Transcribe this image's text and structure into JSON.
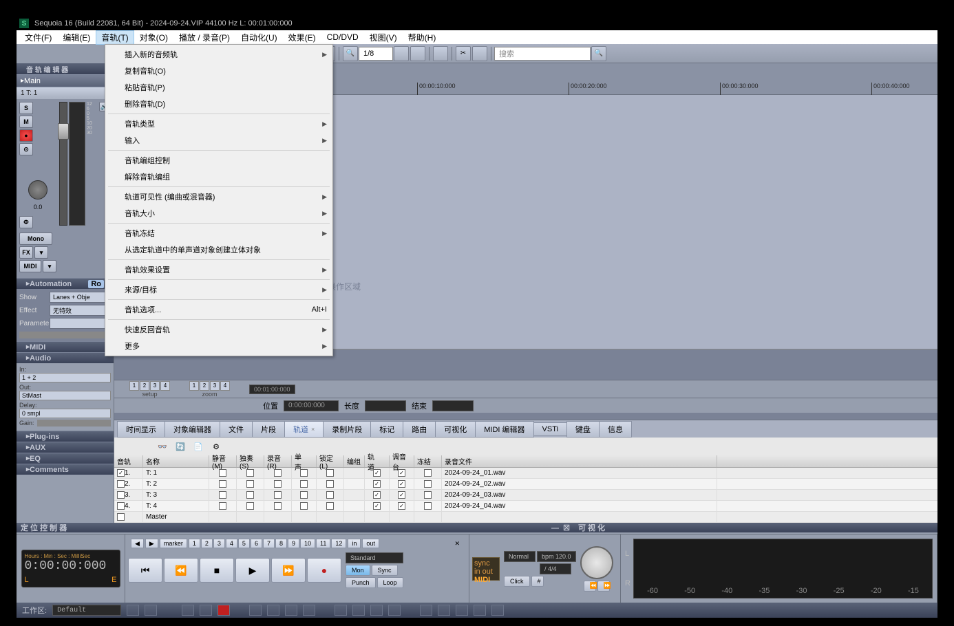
{
  "title": "Sequoia 16 (Build 22081, 64 Bit)  -  2024-09-24.VIP    44100 Hz L: 00:01:00:000",
  "menubar": [
    "文件(F)",
    "编辑(E)",
    "音轨(T)",
    "对象(O)",
    "播放 / 录音(P)",
    "自动化(U)",
    "效果(E)",
    "CD/DVD",
    "视图(V)",
    "帮助(H)"
  ],
  "active_menu_index": 2,
  "dropdown": [
    {
      "label": "插入新的音频轨",
      "sub": true
    },
    {
      "label": "复制音轨(O)"
    },
    {
      "label": "粘贴音轨(P)"
    },
    {
      "label": "删除音轨(D)"
    },
    {
      "sep": true
    },
    {
      "label": "音轨类型",
      "sub": true
    },
    {
      "label": "输入",
      "sub": true
    },
    {
      "sep": true
    },
    {
      "label": "音轨编组控制"
    },
    {
      "label": "解除音轨编组"
    },
    {
      "sep": true
    },
    {
      "label": "轨道可见性 (编曲或混音器)",
      "sub": true
    },
    {
      "label": "音轨大小",
      "sub": true
    },
    {
      "sep": true
    },
    {
      "label": "音轨冻结",
      "sub": true
    },
    {
      "label": "从选定轨道中的单声道对象创建立体对象"
    },
    {
      "sep": true
    },
    {
      "label": "音轨效果设置",
      "sub": true
    },
    {
      "sep": true
    },
    {
      "label": "来源/目标",
      "sub": true
    },
    {
      "sep": true
    },
    {
      "label": "音轨选项...",
      "shortcut": "Alt+I"
    },
    {
      "sep": true
    },
    {
      "label": "快速反回音轨",
      "sub": true
    },
    {
      "label": "更多",
      "sub": true
    }
  ],
  "toolbar": {
    "zoom_ratio": "1/8",
    "search_placeholder": "搜索"
  },
  "panels": {
    "track_editor_header": "音 轨 编 辑 器",
    "main": "Main",
    "track1": "1    T:  1",
    "automation": "Automation",
    "ro": "Ro",
    "show": "Show",
    "show_value": "Lanes + Obje",
    "effect": "Effect",
    "effect_value": "无特效",
    "parameter": "Parameter",
    "midi": "MIDI",
    "audio": "Audio",
    "plugins": "Plug-ins",
    "aux": "AUX",
    "eq": "EQ",
    "comments": "Comments",
    "in": "In:",
    "in_value": "1 + 2",
    "out": "Out:",
    "out_value": "StMast",
    "delay": "Delay:",
    "delay_value": "0 smpl",
    "gain": "Gain:",
    "mono": "Mono",
    "fx": "FX",
    "midi_btn": "MIDI",
    "pan_val": "0.0"
  },
  "ruler": {
    "ticks": [
      "00:00:10:000",
      "00:00:20:000",
      "00:00:30:000",
      "00:00:40:000"
    ],
    "end": "00:01:00:000"
  },
  "zoom": {
    "setup": "setup",
    "zoom": "zoom"
  },
  "pos": {
    "position": "位置",
    "pos_val": "0:00:00:000",
    "length": "长度",
    "end": "结束"
  },
  "tabs": [
    "时间显示",
    "对象编辑器",
    "文件",
    "片段",
    "轨道",
    "录制片段",
    "标记",
    "路由",
    "可视化",
    "MIDI 编辑器",
    "VSTi",
    "键盘",
    "信息"
  ],
  "active_tab": 4,
  "table": {
    "headers": [
      "音轨",
      "名称",
      "静音(M)",
      "独奏(S)",
      "录音(R)",
      "单声...",
      "锁定(L)",
      "编组",
      "轨道...",
      "调音台",
      "冻结",
      "录音文件"
    ],
    "rows": [
      {
        "n": "1.",
        "name": "T:  1",
        "file": "2024-09-24_01.wav",
        "tr": true,
        "mx": true
      },
      {
        "n": "2.",
        "name": "T:  2",
        "file": "2024-09-24_02.wav",
        "tr": true,
        "mx": true
      },
      {
        "n": "3.",
        "name": "T:  3",
        "file": "2024-09-24_03.wav",
        "tr": true,
        "mx": true
      },
      {
        "n": "4.",
        "name": "T:  4",
        "file": "2024-09-24_04.wav",
        "tr": true,
        "mx": true
      },
      {
        "n": "",
        "name": "Master",
        "file": ""
      }
    ]
  },
  "transport": {
    "header": "定 位 控 制 器",
    "vis_header": "可 视 化",
    "td_label": "Hours : Min : Sec : MilliSec",
    "td_time": "0:00:00:000",
    "L": "L",
    "E": "E",
    "marker": "marker",
    "nums": [
      "1",
      "2",
      "3",
      "4",
      "5",
      "6",
      "7",
      "8",
      "9",
      "10",
      "11",
      "12"
    ],
    "in": "in",
    "out": "out",
    "standard": "Standard",
    "mon": "Mon",
    "sync": "Sync",
    "punch": "Punch",
    "loop": "Loop",
    "normal": "Normal",
    "bpm": "bpm 120.0",
    "sig": "/    4/4",
    "sync_box_top": "sync",
    "sync_box_mid": "in out",
    "sync_box_bot": "MIDI",
    "click": "Click",
    "level_L": "L",
    "level_R": "R",
    "level_ticks": [
      "-60",
      "-50",
      "-40",
      "-35",
      "-30",
      "-25",
      "-20",
      "-15"
    ]
  },
  "status": {
    "workspace": "工作区:",
    "default": "Default"
  }
}
